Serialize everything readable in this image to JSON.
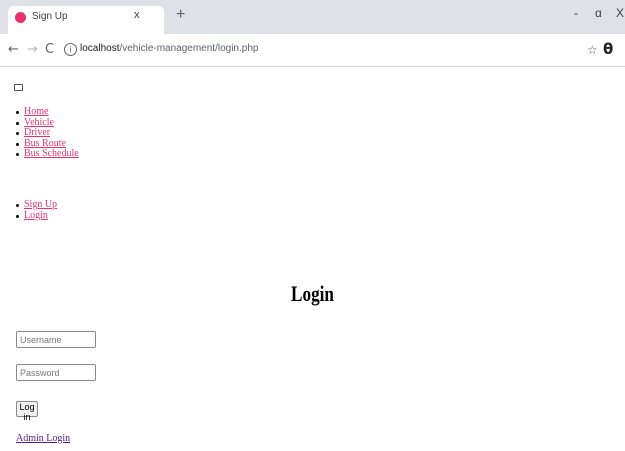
{
  "browser": {
    "tab_title": "Sign Up",
    "tab_close": "x",
    "new_tab": "+",
    "url_host": "localhost",
    "url_path": "/vehicle-management/login.php",
    "window_controls": [
      "-",
      "ɑ",
      "X"
    ],
    "icons": {
      "favicon": "favicon-icon",
      "back": "back-arrow-icon",
      "forward": "forward-arrow-icon",
      "reload": "reload-icon",
      "info": "info-icon",
      "bookmark": "star-icon",
      "profile": "profile-icon",
      "menu": "kebab-menu-icon"
    }
  },
  "nav": {
    "main": [
      "Home",
      "Vehicle",
      "Driver",
      "Bus Route",
      "Bus Schedule"
    ],
    "auth": [
      "Sign Up",
      "Login"
    ]
  },
  "page": {
    "heading": "Login",
    "username_placeholder": "Username",
    "password_placeholder": "Password",
    "submit_label": "Log in",
    "admin_link": "Admin Login"
  },
  "colors": {
    "link": "#e8336d",
    "visited_link": "#551a8b",
    "tabstrip": "#dee1e6"
  }
}
